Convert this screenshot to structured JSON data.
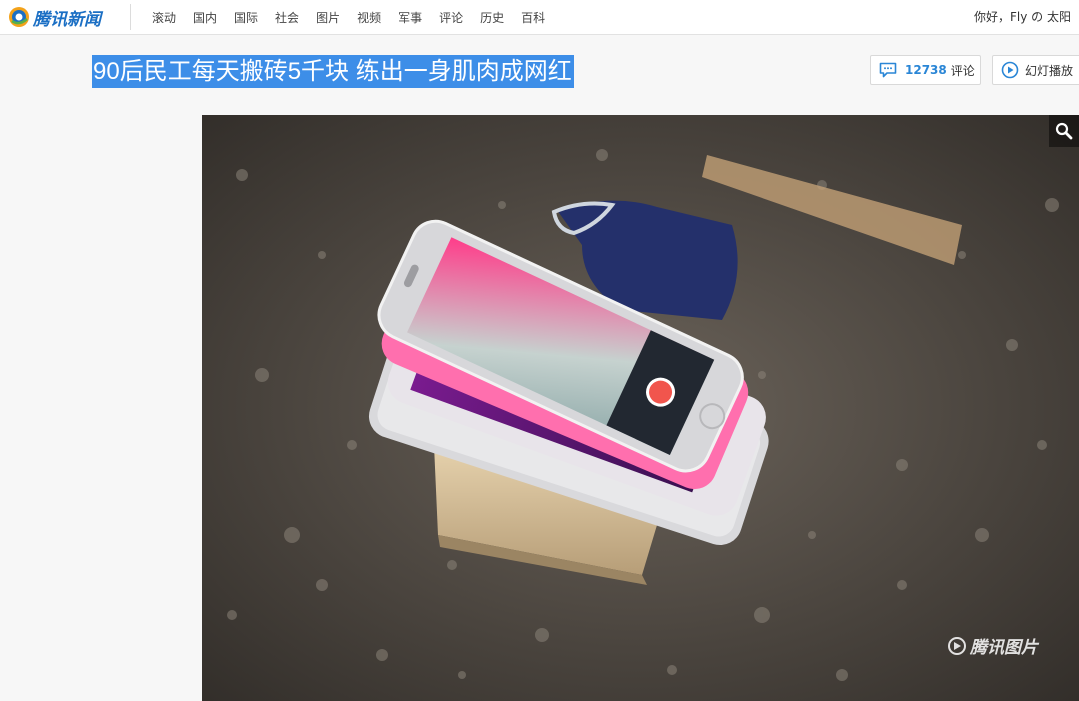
{
  "header": {
    "logo_text": "腾讯新闻",
    "nav": [
      "滚动",
      "国内",
      "国际",
      "社会",
      "图片",
      "视频",
      "军事",
      "评论",
      "历史",
      "百科"
    ],
    "greeting": "你好，Fly の 太阳"
  },
  "article": {
    "title": "90后民工每天搬砖5千块 练出一身肌肉成网红",
    "comment_count": "12738",
    "comment_label": "评论",
    "slideshow_label": "幻灯播放"
  },
  "photo": {
    "watermark": "腾讯图片"
  },
  "colors": {
    "brand_blue": "#1b6fc4",
    "title_highlight": "#3d8ee8",
    "count_blue": "#2a86d6"
  },
  "icons": [
    "tencent-news-logo-icon",
    "comment-icon",
    "play-circle-icon",
    "magnifier-icon",
    "tencent-photo-logo-icon"
  ]
}
